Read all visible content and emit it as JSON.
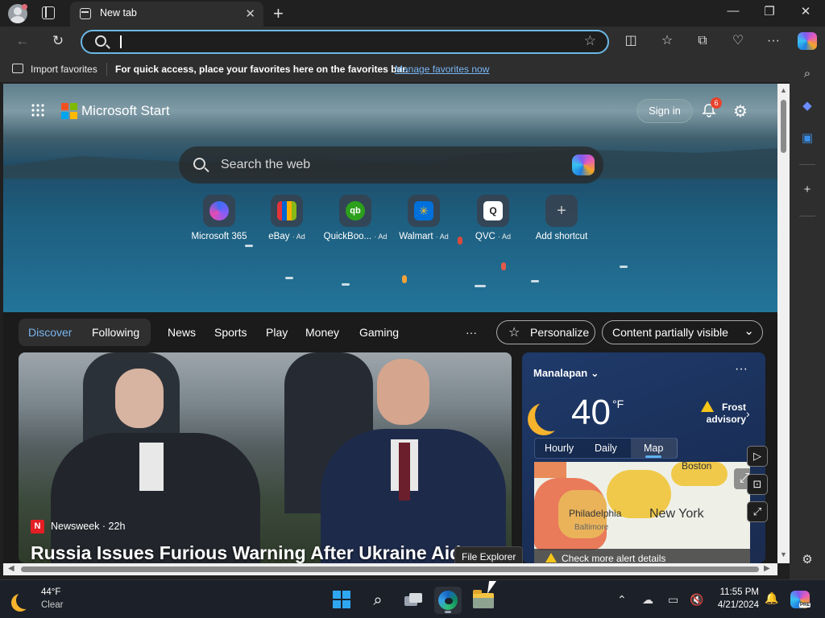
{
  "browser": {
    "tab_title": "New tab",
    "address_placeholder": "",
    "favorites_bar": {
      "import_label": "Import favorites",
      "hint": "For quick access, place your favorites here on the favorites bar.",
      "manage_link": "Manage favorites now"
    }
  },
  "start_page": {
    "brand": "Microsoft Start",
    "sign_in": "Sign in",
    "notification_count": "6",
    "search_placeholder": "Search the web",
    "shortcuts": [
      {
        "label": "Microsoft 365",
        "ad": "",
        "icon": "microsoft-365-icon",
        "color": "#7b61ff"
      },
      {
        "label": "eBay",
        "ad": "· Ad",
        "icon": "ebay-icon",
        "color": "#e53238"
      },
      {
        "label": "QuickBoo...",
        "ad": "· Ad",
        "icon": "quickbooks-icon",
        "color": "#2ca01c"
      },
      {
        "label": "Walmart",
        "ad": "· Ad",
        "icon": "walmart-icon",
        "color": "#0071dc"
      },
      {
        "label": "QVC",
        "ad": "· Ad",
        "icon": "qvc-icon",
        "color": "#ffffff"
      },
      {
        "label": "Add shortcut",
        "ad": "",
        "icon": "plus-icon",
        "color": "#555555"
      }
    ],
    "feed_nav": {
      "discover": "Discover",
      "following": "Following",
      "links": [
        "News",
        "Sports",
        "Play",
        "Money",
        "Gaming"
      ],
      "more": "···",
      "personalize": "Personalize",
      "content_visibility": "Content partially visible"
    },
    "news": {
      "source": "Newsweek · 22h",
      "source_icon_letter": "N",
      "headline": "Russia Issues Furious Warning After Ukraine Aid"
    },
    "weather": {
      "location": "Manalapan",
      "temperature": "40",
      "unit": "°F",
      "alert": "Frost advisory",
      "tabs": [
        "Hourly",
        "Daily",
        "Map"
      ],
      "active_tab": "Map",
      "map_labels": {
        "boston": "Boston",
        "philadelphia": "Philadelphia",
        "baltimore": "Baltimore",
        "new_york": "New York"
      },
      "alert_details": "Check more alert details"
    }
  },
  "tooltip": "File Explorer",
  "taskbar": {
    "weather_temp": "44°F",
    "weather_condition": "Clear",
    "time": "11:55 PM",
    "date": "4/21/2024"
  },
  "colors": {
    "accent": "#78b5ef",
    "omnibox_border": "#6cb8e6",
    "alert_badge": "#e8432d",
    "weather_moon": "#f6b32c"
  }
}
